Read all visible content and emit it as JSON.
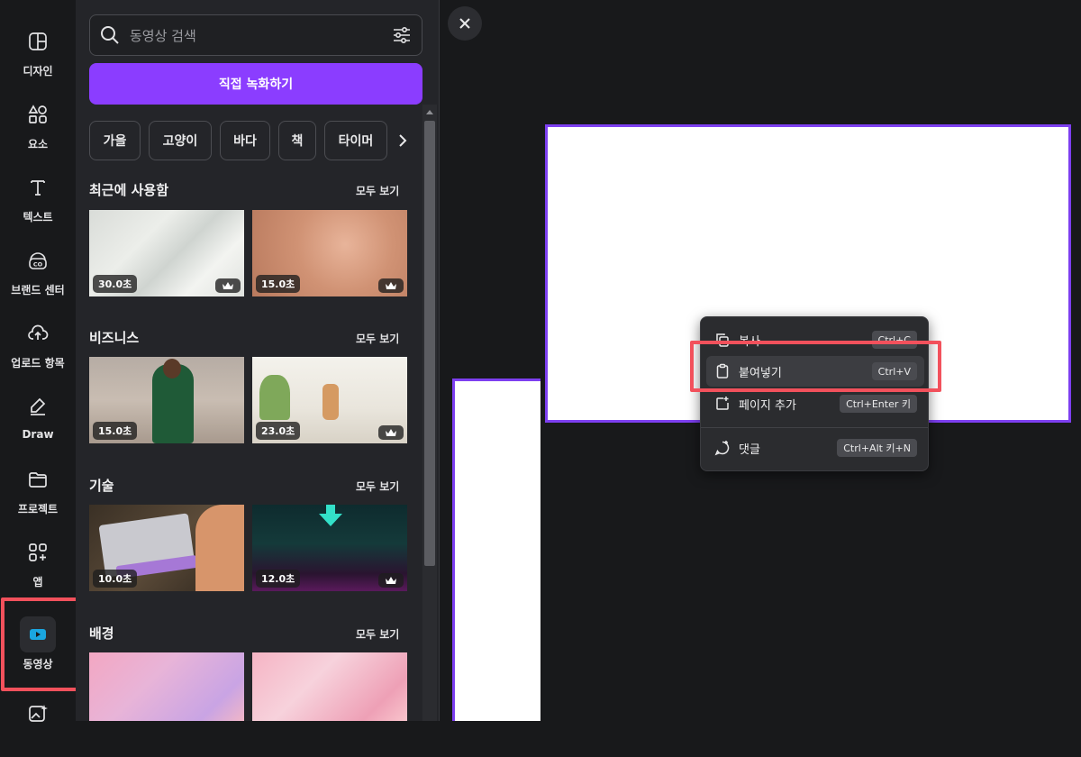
{
  "rail": {
    "items": [
      {
        "label": "디자인",
        "icon": "design-icon"
      },
      {
        "label": "요소",
        "icon": "elements-icon"
      },
      {
        "label": "텍스트",
        "icon": "text-icon"
      },
      {
        "label": "브랜드 센터",
        "icon": "brand-center-icon"
      },
      {
        "label": "업로드 항목",
        "icon": "upload-icon"
      },
      {
        "label": "Draw",
        "icon": "draw-icon"
      },
      {
        "label": "프로젝트",
        "icon": "folder-icon"
      },
      {
        "label": "앱",
        "icon": "apps-icon"
      },
      {
        "label": "동영상",
        "icon": "video-icon"
      }
    ],
    "active": "동영상",
    "highlight_color": "#f2515c"
  },
  "panel": {
    "search_placeholder": "동영상 검색",
    "record_button": "직접 녹화하기",
    "chips": [
      "가을",
      "고양이",
      "바다",
      "책",
      "타이머"
    ],
    "see_all": "모두 보기",
    "sections": [
      {
        "title": "최근에 사용함",
        "videos": [
          {
            "duration": "30.0초",
            "premium": true
          },
          {
            "duration": "15.0초",
            "premium": true
          }
        ]
      },
      {
        "title": "비즈니스",
        "videos": [
          {
            "duration": "15.0초",
            "premium": false
          },
          {
            "duration": "23.0초",
            "premium": true
          }
        ]
      },
      {
        "title": "기술",
        "videos": [
          {
            "duration": "10.0초",
            "premium": false
          },
          {
            "duration": "12.0초",
            "premium": true
          }
        ]
      },
      {
        "title": "배경",
        "videos": [
          {
            "duration": "",
            "premium": false
          },
          {
            "duration": "",
            "premium": false
          }
        ]
      }
    ]
  },
  "context_menu": {
    "items": [
      {
        "label": "복사",
        "shortcut": "Ctrl+C",
        "icon": "copy-icon"
      },
      {
        "label": "붙여넣기",
        "shortcut": "Ctrl+V",
        "icon": "paste-icon"
      },
      {
        "label": "페이지 추가",
        "shortcut": "Ctrl+Enter 키",
        "icon": "add-page-icon"
      },
      {
        "label": "댓글",
        "shortcut": "Ctrl+Alt 키+N",
        "icon": "comment-icon"
      }
    ],
    "highlighted": "붙여넣기"
  },
  "colors": {
    "accent": "#8b3dff",
    "page_border": "#7d3ff0",
    "background": "#18191b",
    "panel": "#242529"
  }
}
